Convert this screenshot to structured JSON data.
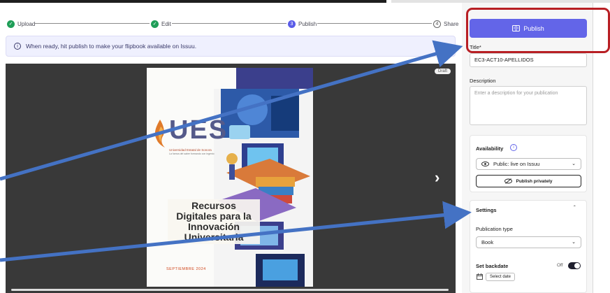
{
  "steps": [
    {
      "label": "Upload",
      "state": "done"
    },
    {
      "label": "Edit",
      "state": "done"
    },
    {
      "label": "Publish",
      "state": "current",
      "number": "3"
    },
    {
      "label": "Share",
      "state": "todo",
      "number": "4"
    }
  ],
  "banner": {
    "text": "When ready, hit publish to make your flipbook available on Issuu."
  },
  "preview": {
    "draft_badge": "Draft",
    "cover": {
      "logo_word": "UES",
      "logo_line1": "Universidad Estatal de Sonora",
      "logo_line2": "La fuerza del saber formando con ingenio",
      "title_line1": "Recursos",
      "title_line2": "Digitales para la",
      "title_line3": "Innovación",
      "title_line4": "Universitaria",
      "date": "SEPTIEMBRE 2024"
    }
  },
  "panel": {
    "publish_label": "Publish",
    "title_label": "Title*",
    "title_value": "EC3-ACT10-APELLIDOS",
    "description_label": "Description",
    "description_placeholder": "Enter a description for your publication",
    "availability_label": "Availability",
    "availability_value": "Public: live on Issuu",
    "publish_privately_label": "Publish privately",
    "settings_label": "Settings",
    "publication_type_label": "Publication type",
    "publication_type_value": "Book",
    "set_backdate_label": "Set backdate",
    "backdate_toggle_label": "Off",
    "select_date_label": "Select date"
  },
  "colors": {
    "accent": "#6365e8",
    "step_done": "#1f9e58",
    "highlight": "#b81f24",
    "arrow": "#4472c4"
  }
}
